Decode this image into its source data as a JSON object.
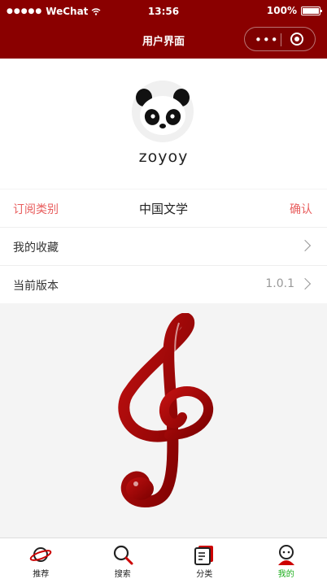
{
  "status_bar": {
    "carrier": "WeChat",
    "time": "13:56",
    "battery": "100%"
  },
  "nav": {
    "title": "用户界面"
  },
  "profile": {
    "username": "zoyoy"
  },
  "subscription": {
    "label": "订阅类别",
    "value": "中国文学",
    "confirm_label": "确认"
  },
  "menu": [
    {
      "label": "我的收藏",
      "value": ""
    },
    {
      "label": "当前版本",
      "value": "1.0.1"
    }
  ],
  "tabbar": [
    {
      "label": "推荐",
      "icon": "planet-icon"
    },
    {
      "label": "搜索",
      "icon": "search-icon"
    },
    {
      "label": "分类",
      "icon": "category-icon"
    },
    {
      "label": "我的",
      "icon": "user-icon",
      "active": true
    }
  ],
  "colors": {
    "brand": "#8a0000",
    "accent_red": "#e85d5d",
    "active_tab": "#1aad19"
  }
}
